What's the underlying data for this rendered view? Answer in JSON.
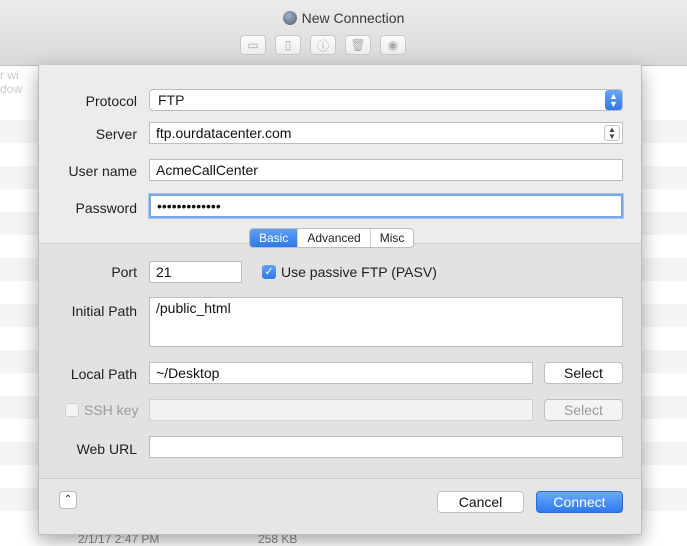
{
  "window": {
    "title": "New Connection",
    "toolbar": [
      "new-folder-icon",
      "new-file-icon",
      "info-icon",
      "trash-icon",
      "eye-icon"
    ],
    "bg_left_text": [
      "r wi",
      "dow"
    ],
    "bg_footer": {
      "date": "2/1/17 2:47 PM",
      "size": "258 KB"
    }
  },
  "form": {
    "protocol_label": "Protocol",
    "protocol_value": "FTP",
    "server_label": "Server",
    "server_value": "ftp.ourdatacenter.com",
    "username_label": "User name",
    "username_value": "AcmeCallCenter",
    "password_label": "Password",
    "password_value": "•••••••••••••"
  },
  "tabs": [
    "Basic",
    "Advanced",
    "Misc"
  ],
  "basic": {
    "port_label": "Port",
    "port_value": "21",
    "passive_label": "Use passive FTP (PASV)",
    "initial_path_label": "Initial Path",
    "initial_path_value": "/public_html",
    "local_path_label": "Local Path",
    "local_path_value": "~/Desktop",
    "select_label": "Select",
    "sshkey_label": "SSH key",
    "sshkey_select_label": "Select",
    "weburl_label": "Web URL",
    "weburl_value": ""
  },
  "actions": {
    "cancel": "Cancel",
    "connect": "Connect"
  }
}
